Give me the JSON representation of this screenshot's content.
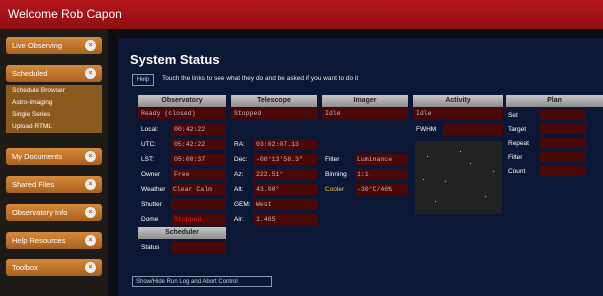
{
  "header": {
    "welcome": "Welcome Rob Capon"
  },
  "sidebar": {
    "items": [
      {
        "label": "Live Observing"
      },
      {
        "label": "Scheduled"
      },
      {
        "label": "My Documents"
      },
      {
        "label": "Shared Files"
      },
      {
        "label": "Observatory Info"
      },
      {
        "label": "Help Resources"
      },
      {
        "label": "Toolbox"
      }
    ],
    "scheduled_sub": [
      "Schedule Browser",
      "Astro-Imaging",
      "Single Series",
      "Upload RTML"
    ]
  },
  "main": {
    "title": "System Status",
    "help_label": "Help",
    "help_text": "Touch the links to see what they do and be asked if you want to do it",
    "toggle_label": "Show/Hide Run Log and Abort Control"
  },
  "observatory": {
    "header": "Observatory",
    "status": "Ready (closed)",
    "local_label": "Local:",
    "local_value": "00:42:22",
    "utc_label": "UTC:",
    "utc_value": "05:42:22",
    "lst_label": "LST:",
    "lst_value": "05:00:37",
    "owner_label": "Owner",
    "owner_value": "Free",
    "weather_label": "Weather",
    "weather_value": "Clear Calm",
    "shutter_label": "Shutter",
    "dome_label": "Dome",
    "dome_value": "Stopped"
  },
  "scheduler": {
    "header": "Scheduler",
    "status_label": "Status"
  },
  "telescope": {
    "header": "Telescope",
    "status": "Stopped",
    "ra_label": "RA:",
    "ra_value": "03:02:07.13",
    "dec_label": "Dec:",
    "dec_value": "-00°13'58.3\"",
    "az_label": "Az:",
    "az_value": "222.51°",
    "alt_label": "Alt:",
    "alt_value": "43.00°",
    "gem_label": "GEM:",
    "gem_value": "West",
    "air_label": "Air:",
    "air_value": "1.465"
  },
  "imager": {
    "header": "Imager",
    "status": "Idle",
    "filter_label": "Filter",
    "filter_value": "Luminance",
    "binning_label": "Binning",
    "binning_value": "1:1",
    "cooler_label": "Cooler",
    "cooler_value": "-30°C/46%"
  },
  "activity": {
    "header": "Activity",
    "status": "Idle",
    "fwhm_label": "FWHM"
  },
  "plan": {
    "header": "Plan",
    "set_label": "Set",
    "target_label": "Target",
    "repeat_label": "Repeat",
    "filter_label": "Filter",
    "count_label": "Count"
  },
  "colors": {
    "topbar": "#a8161a",
    "main_bg": "#0b1734",
    "value_box": "#4a0808",
    "sidebar_button": "#c47a30"
  }
}
